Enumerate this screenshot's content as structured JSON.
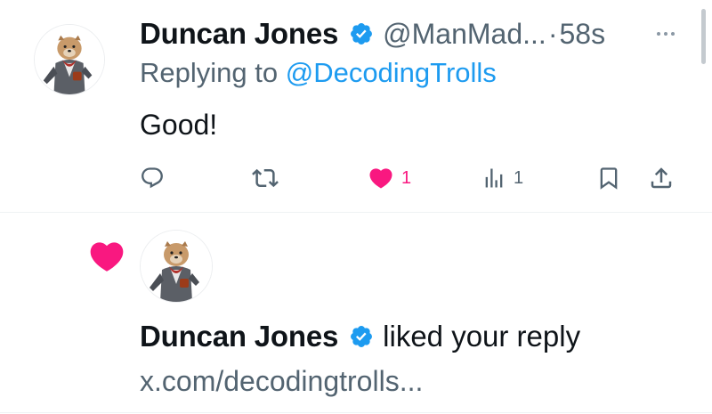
{
  "tweet": {
    "author_name": "Duncan Jones",
    "handle": "@ManMad...",
    "separator": "·",
    "time": "58s",
    "replying_prefix": "Replying to",
    "replying_to": "@DecodingTrolls",
    "text": "Good!",
    "actions": {
      "like_count": "1",
      "views_count": "1"
    },
    "liked": true
  },
  "notification": {
    "user_name": "Duncan Jones",
    "action_text": "liked your reply",
    "link": "x.com/decodingtrolls..."
  },
  "colors": {
    "accent_blue": "#1d9bf0",
    "like_pink": "#f91880",
    "secondary_text": "#536471",
    "primary_text": "#0f1419"
  }
}
